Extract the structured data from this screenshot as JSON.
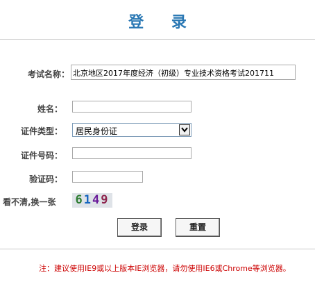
{
  "page": {
    "title": "登 录"
  },
  "form": {
    "exam_name": {
      "label": "考试名称：",
      "value": "北京地区2017年度经济（初级）专业技术资格考试201711"
    },
    "name": {
      "label": "姓名：",
      "value": ""
    },
    "id_type": {
      "label": "证件类型：",
      "selected": "居民身份证"
    },
    "id_number": {
      "label": "证件号码：",
      "value": ""
    },
    "captcha": {
      "label": "验证码：",
      "value": "",
      "refresh_link": "看不清,换一张",
      "image_digits": [
        "6",
        "1",
        "4",
        "9"
      ]
    }
  },
  "buttons": {
    "login": "登录",
    "reset": "重置"
  },
  "footer": {
    "note": "注：建议使用IE9或以上版本IE浏览器，请勿使用IE6或Chrome等浏览器。"
  },
  "colors": {
    "title": "#2a78b4",
    "note": "#cc0000"
  }
}
